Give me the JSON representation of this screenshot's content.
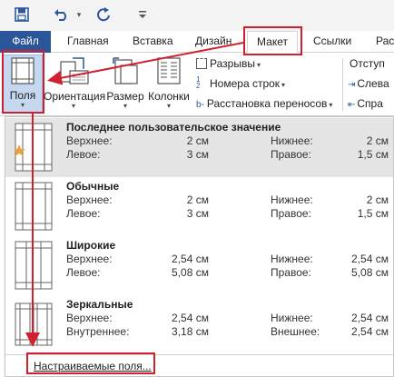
{
  "colors": {
    "brand": "#2b579a",
    "annotation": "#d02030",
    "highlight": "#e5e5e5"
  },
  "quick_access": {
    "icons": [
      "save-icon",
      "undo-icon",
      "redo-icon",
      "customize-icon"
    ]
  },
  "tabs": {
    "file": "Файл",
    "items": [
      "Главная",
      "Вставка",
      "Дизайн",
      "Макет",
      "Ссылки",
      "Расс"
    ],
    "active": "Макет"
  },
  "ribbon": {
    "margins": "Поля",
    "orientation": "Ориентация",
    "size": "Размер",
    "columns": "Колонки",
    "breaks": "Разрывы",
    "line_numbers": "Номера строк",
    "hyphenation": "Расстановка переносов",
    "indent_header": "Отступ",
    "indent_left": "Слева",
    "indent_right": "Спра"
  },
  "margins_menu": {
    "options": [
      {
        "title": "Последнее пользовательское значение",
        "top_label": "Верхнее:",
        "top": "2 см",
        "bottom_label": "Нижнее:",
        "bottom": "2 см",
        "left_label": "Левое:",
        "left": "3 см",
        "right_label": "Правое:",
        "right": "1,5 см"
      },
      {
        "title": "Обычные",
        "top_label": "Верхнее:",
        "top": "2 см",
        "bottom_label": "Нижнее:",
        "bottom": "2 см",
        "left_label": "Левое:",
        "left": "3 см",
        "right_label": "Правое:",
        "right": "1,5 см"
      },
      {
        "title": "Широкие",
        "top_label": "Верхнее:",
        "top": "2,54 см",
        "bottom_label": "Нижнее:",
        "bottom": "2,54 см",
        "left_label": "Левое:",
        "left": "5,08 см",
        "right_label": "Правое:",
        "right": "5,08 см"
      },
      {
        "title": "Зеркальные",
        "top_label": "Верхнее:",
        "top": "2,54 см",
        "bottom_label": "Нижнее:",
        "bottom": "2,54 см",
        "left_label": "Внутреннее:",
        "left": "3,18 см",
        "right_label": "Внешнее:",
        "right": "2,54 см"
      }
    ],
    "custom": "Настраиваемые поля..."
  }
}
